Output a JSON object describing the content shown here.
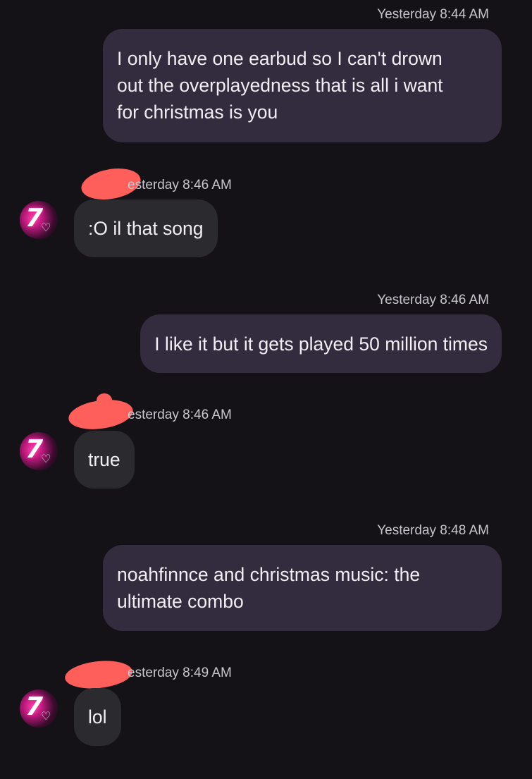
{
  "messages": [
    {
      "direction": "outgoing",
      "timestamp": "Yesterday 8:44 AM",
      "lines": [
        "I only have one earbud so I can't drown",
        "out the overplayedness that is all i want",
        "for christmas is you"
      ]
    },
    {
      "direction": "incoming",
      "timestamp": "Yesterday 8:46 AM",
      "timestamp_visible": "esterday 8:46 AM",
      "text": ":O il that song"
    },
    {
      "direction": "outgoing",
      "timestamp": "Yesterday 8:46 AM",
      "text": "I like it but it gets played 50 million times"
    },
    {
      "direction": "incoming",
      "timestamp": "Yesterday 8:46 AM",
      "timestamp_visible": "esterday 8:46 AM",
      "text": "true"
    },
    {
      "direction": "outgoing",
      "timestamp": "Yesterday 8:48 AM",
      "lines": [
        "noahfinnce and christmas music: the",
        "ultimate combo"
      ]
    },
    {
      "direction": "incoming",
      "timestamp": "Yesterday 8:49 AM",
      "timestamp_visible": "esterday 8:49 AM",
      "text": "lol"
    }
  ],
  "avatar": {
    "glyph": "7",
    "badge": "♡",
    "accent": "#ff3ea8"
  },
  "colors": {
    "background": "#141217",
    "outgoing_bubble": "#332c3e",
    "incoming_bubble": "#2b2a2e",
    "redaction": "#ff5f5a"
  }
}
